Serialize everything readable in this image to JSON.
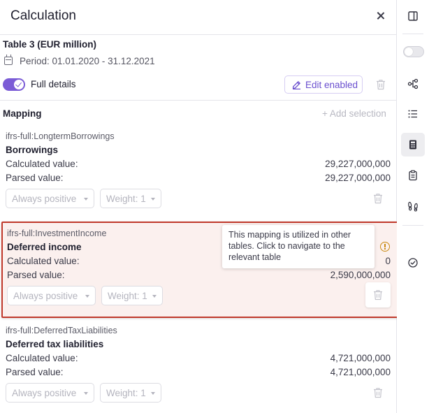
{
  "header": {
    "title": "Calculation"
  },
  "table": {
    "title": "Table 3 (EUR million)",
    "period": "Period: 01.01.2020 - 31.12.2021",
    "full_details_label": "Full details",
    "full_details_on": true,
    "edit_label": "Edit enabled"
  },
  "mapping": {
    "label": "Mapping",
    "add_selection": "+ Add selection",
    "items": [
      {
        "code": "ifrs-full:LongtermBorrowings",
        "name": "Borrowings",
        "calculated_label": "Calculated value:",
        "calculated_value": "29,227,000,000",
        "parsed_label": "Parsed value:",
        "parsed_value": "29,227,000,000",
        "sign": "Always positive",
        "weight": "Weight: 1"
      },
      {
        "code": "ifrs-full:InvestmentIncome",
        "name": "Deferred income",
        "calculated_label": "Calculated value:",
        "calculated_value": "0",
        "parsed_label": "Parsed value:",
        "parsed_value": "2,590,000,000",
        "sign": "Always positive",
        "weight": "Weight: 1",
        "tooltip": "This mapping is utilized in other tables. Click to navigate to the relevant table"
      },
      {
        "code": "ifrs-full:DeferredTaxLiabilities",
        "name": "Deferred tax liabilities",
        "calculated_label": "Calculated value:",
        "calculated_value": "4,721,000,000",
        "parsed_label": "Parsed value:",
        "parsed_value": "4,721,000,000",
        "sign": "Always positive",
        "weight": "Weight: 1"
      }
    ]
  },
  "rail": {
    "icons": [
      "panel-icon",
      "toggle-icon",
      "hierarchy-icon",
      "list-icon",
      "calculator-icon",
      "clipboard-icon",
      "footprints-icon",
      "check-circle-icon"
    ],
    "active": "calculator-icon"
  },
  "colors": {
    "accent": "#7b5cd6",
    "highlight_border": "#c0392b",
    "highlight_bg": "#fbf0ee",
    "warning": "#c98a12"
  }
}
